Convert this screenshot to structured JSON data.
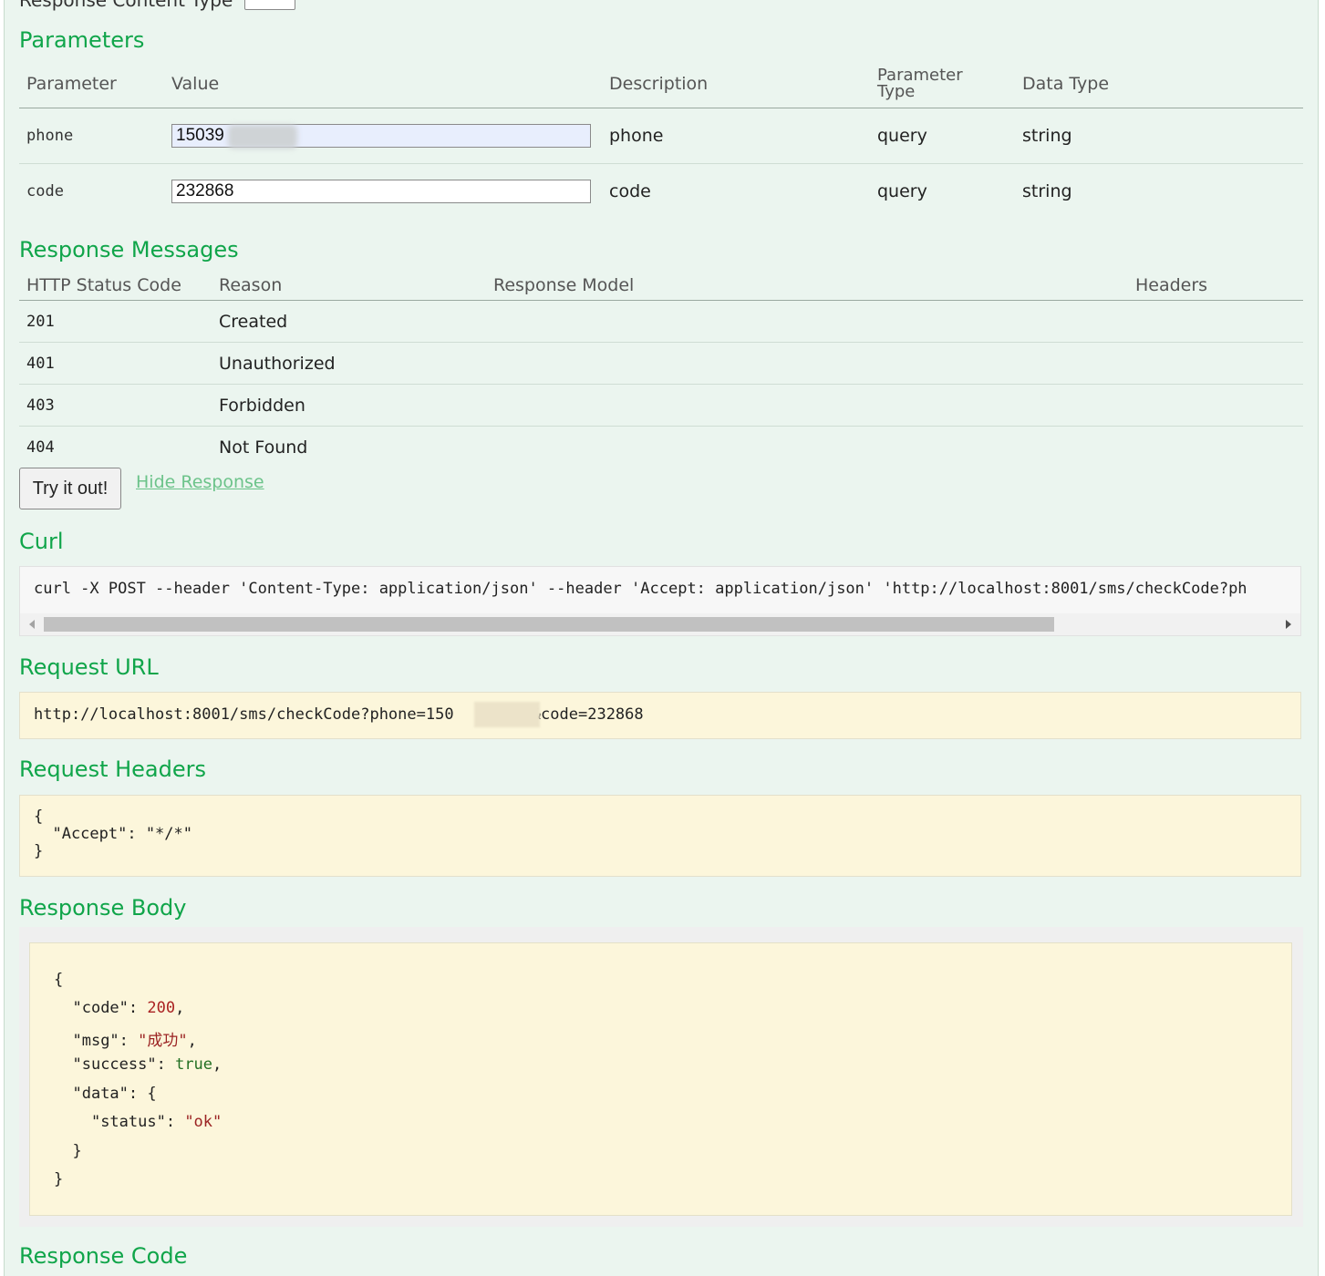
{
  "response_content_type_label": "Response Content Type",
  "sections": {
    "parameters": "Parameters",
    "response_messages": "Response Messages",
    "curl": "Curl",
    "request_url": "Request URL",
    "request_headers": "Request Headers",
    "response_body": "Response Body",
    "response_code": "Response Code"
  },
  "parameters": {
    "headers": [
      "Parameter",
      "Value",
      "Description",
      "Parameter Type",
      "Data Type"
    ],
    "header_ptype_line1": "Parameter",
    "header_ptype_line2": "Type",
    "rows": [
      {
        "name": "phone",
        "value": "15039",
        "description": "phone",
        "type": "query",
        "data_type": "string"
      },
      {
        "name": "code",
        "value": "232868",
        "description": "code",
        "type": "query",
        "data_type": "string"
      }
    ]
  },
  "response_messages": {
    "headers": [
      "HTTP Status Code",
      "Reason",
      "Response Model",
      "Headers"
    ],
    "rows": [
      {
        "code": "201",
        "reason": "Created"
      },
      {
        "code": "401",
        "reason": "Unauthorized"
      },
      {
        "code": "403",
        "reason": "Forbidden"
      },
      {
        "code": "404",
        "reason": "Not Found"
      }
    ]
  },
  "actions": {
    "try_button": "Try it out!",
    "hide_response": "Hide Response"
  },
  "curl": "curl -X POST --header 'Content-Type: application/json' --header 'Accept: application/json' 'http://localhost:8001/sms/checkCode?ph",
  "request_url": {
    "prefix": "http://localhost:8001/sms/checkCode?phone=150",
    "suffix": "6&code=232868"
  },
  "request_headers": {
    "open": "{",
    "line": "  \"Accept\": \"*/*\"",
    "close": "}"
  },
  "response_body": {
    "code_key": "\"code\": ",
    "code_val": "200",
    "msg_key": "\"msg\": ",
    "msg_val": "\"成功\"",
    "success_key": "\"success\": ",
    "success_val": "true",
    "data_key": "\"data\": {",
    "status_key": "\"status\": ",
    "status_val": "\"ok\""
  },
  "colors": {
    "heading": "#10a54a",
    "panel": "#ebf5ef",
    "code_bg": "#fcf6db"
  }
}
